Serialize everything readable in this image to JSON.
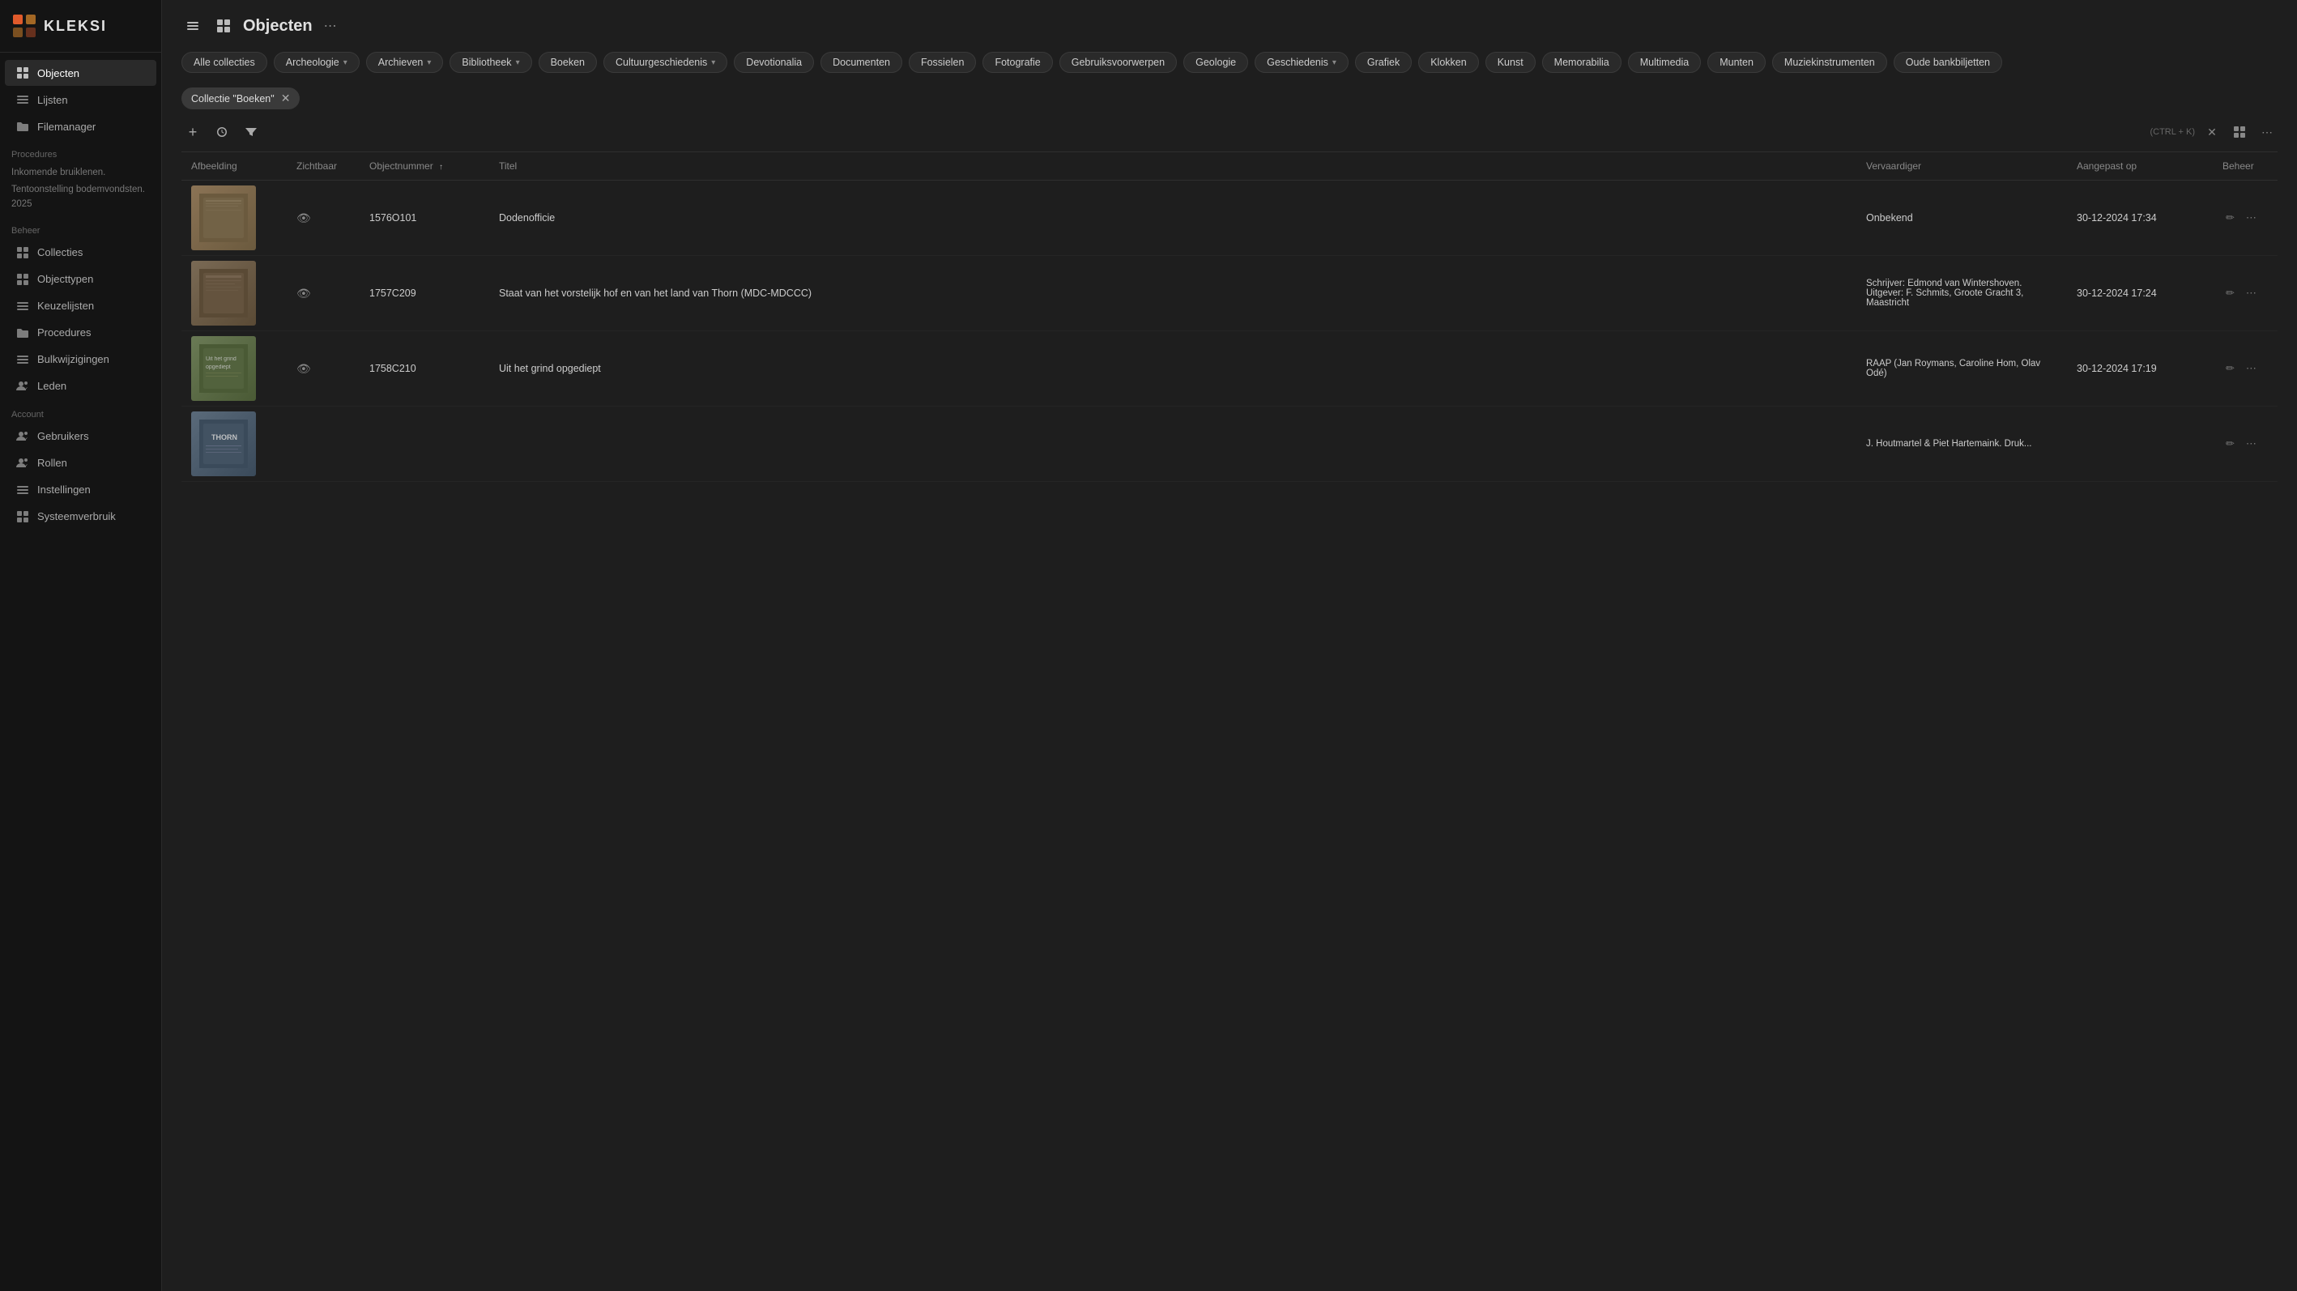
{
  "sidebar": {
    "logo_text": "KLEKSI",
    "main_nav": [
      {
        "id": "objecten",
        "label": "Objecten",
        "icon": "grid"
      },
      {
        "id": "lijsten",
        "label": "Lijsten",
        "icon": "list"
      },
      {
        "id": "filemanager",
        "label": "Filemanager",
        "icon": "folder"
      }
    ],
    "procedures_label": "Procedures",
    "procedures_items": [
      "Inkomende bruiklenen.",
      "Tentoonstelling bodemvondsten. 2025"
    ],
    "beheer_label": "Beheer",
    "beheer_nav": [
      {
        "id": "collecties",
        "label": "Collecties",
        "icon": "grid-small"
      },
      {
        "id": "objecttypen",
        "label": "Objecttypen",
        "icon": "grid-small2"
      },
      {
        "id": "keuzeijsten",
        "label": "Keuzelijsten",
        "icon": "list2"
      },
      {
        "id": "procedures",
        "label": "Procedures",
        "icon": "folder2"
      },
      {
        "id": "bulkwijzigingen",
        "label": "Bulkwijzigingen",
        "icon": "list3"
      },
      {
        "id": "leden",
        "label": "Leden",
        "icon": "users"
      }
    ],
    "account_label": "Account",
    "account_nav": [
      {
        "id": "gebruikers",
        "label": "Gebruikers",
        "icon": "users2"
      },
      {
        "id": "rollen",
        "label": "Rollen",
        "icon": "users3"
      },
      {
        "id": "instellingen",
        "label": "Instellingen",
        "icon": "list4"
      },
      {
        "id": "systeemverbruik",
        "label": "Systeemverbruik",
        "icon": "grid3"
      }
    ]
  },
  "page": {
    "title": "Objecten",
    "hamburger_label": "menu"
  },
  "filters": {
    "active_collection": "Collectie \"Boeken\"",
    "chips": [
      {
        "label": "Alle collecties",
        "has_chevron": false
      },
      {
        "label": "Archeologie",
        "has_chevron": true
      },
      {
        "label": "Archieven",
        "has_chevron": true
      },
      {
        "label": "Bibliotheek",
        "has_chevron": true
      },
      {
        "label": "Boeken",
        "has_chevron": false
      },
      {
        "label": "Cultuurgeschiedenis",
        "has_chevron": true
      },
      {
        "label": "Devotionalia",
        "has_chevron": false
      },
      {
        "label": "Documenten",
        "has_chevron": false
      },
      {
        "label": "Fossielen",
        "has_chevron": false
      },
      {
        "label": "Fotografie",
        "has_chevron": false
      },
      {
        "label": "Gebruiksvoorwerpen",
        "has_chevron": false
      },
      {
        "label": "Geologie",
        "has_chevron": false
      },
      {
        "label": "Geschiedenis",
        "has_chevron": true
      },
      {
        "label": "Grafiek",
        "has_chevron": false
      },
      {
        "label": "Klokken",
        "has_chevron": false
      },
      {
        "label": "Kunst",
        "has_chevron": false
      },
      {
        "label": "Memorabilia",
        "has_chevron": false
      },
      {
        "label": "Multimedia",
        "has_chevron": false
      },
      {
        "label": "Munten",
        "has_chevron": false
      },
      {
        "label": "Muziekinstrumenten",
        "has_chevron": false
      },
      {
        "label": "Oude bankbiljetten",
        "has_chevron": false
      }
    ]
  },
  "toolbar": {
    "shortcut": "(CTRL + K)",
    "add_label": "+",
    "history_label": "history",
    "filter_label": "filter"
  },
  "table": {
    "columns": [
      {
        "id": "afbeelding",
        "label": "Afbeelding",
        "sortable": false
      },
      {
        "id": "zichtbaar",
        "label": "Zichtbaar",
        "sortable": false
      },
      {
        "id": "objectnummer",
        "label": "Objectnummer",
        "sortable": true
      },
      {
        "id": "titel",
        "label": "Titel",
        "sortable": false
      },
      {
        "id": "vervaardiger",
        "label": "Vervaardiger",
        "sortable": false
      },
      {
        "id": "aangepast_op",
        "label": "Aangepast op",
        "sortable": false
      },
      {
        "id": "beheer",
        "label": "Beheer",
        "sortable": false
      }
    ],
    "rows": [
      {
        "id": 1,
        "thumb_style": "thumb-1",
        "thumb_text": "",
        "visible": true,
        "objectnummer": "1576O101",
        "titel": "Dodenofficie",
        "vervaardiger": "Onbekend",
        "aangepast_op": "30-12-2024 17:34"
      },
      {
        "id": 2,
        "thumb_style": "thumb-2",
        "thumb_text": "",
        "visible": true,
        "objectnummer": "1757C209",
        "titel": "Staat van het vorstelijk hof en van het land van Thorn (MDC-MDCCC)",
        "vervaardiger": "Schrijver: Edmond van Wintershoven. Uitgever: F. Schmits, Groote Gracht 3, Maastricht",
        "aangepast_op": "30-12-2024 17:24"
      },
      {
        "id": 3,
        "thumb_style": "thumb-3",
        "thumb_text": "Uit het grind opgediept",
        "visible": true,
        "objectnummer": "1758C210",
        "titel": "Uit het grind opgediept",
        "vervaardiger": "RAAP (Jan Roymans, Caroline Hom, Olav Odé)",
        "aangepast_op": "30-12-2024 17:19"
      },
      {
        "id": 4,
        "thumb_style": "thumb-4",
        "thumb_text": "THORN",
        "visible": false,
        "objectnummer": "",
        "titel": "",
        "vervaardiger": "J. Houtmartel & Piet Hartemaink. Druk...",
        "aangepast_op": ""
      }
    ]
  }
}
